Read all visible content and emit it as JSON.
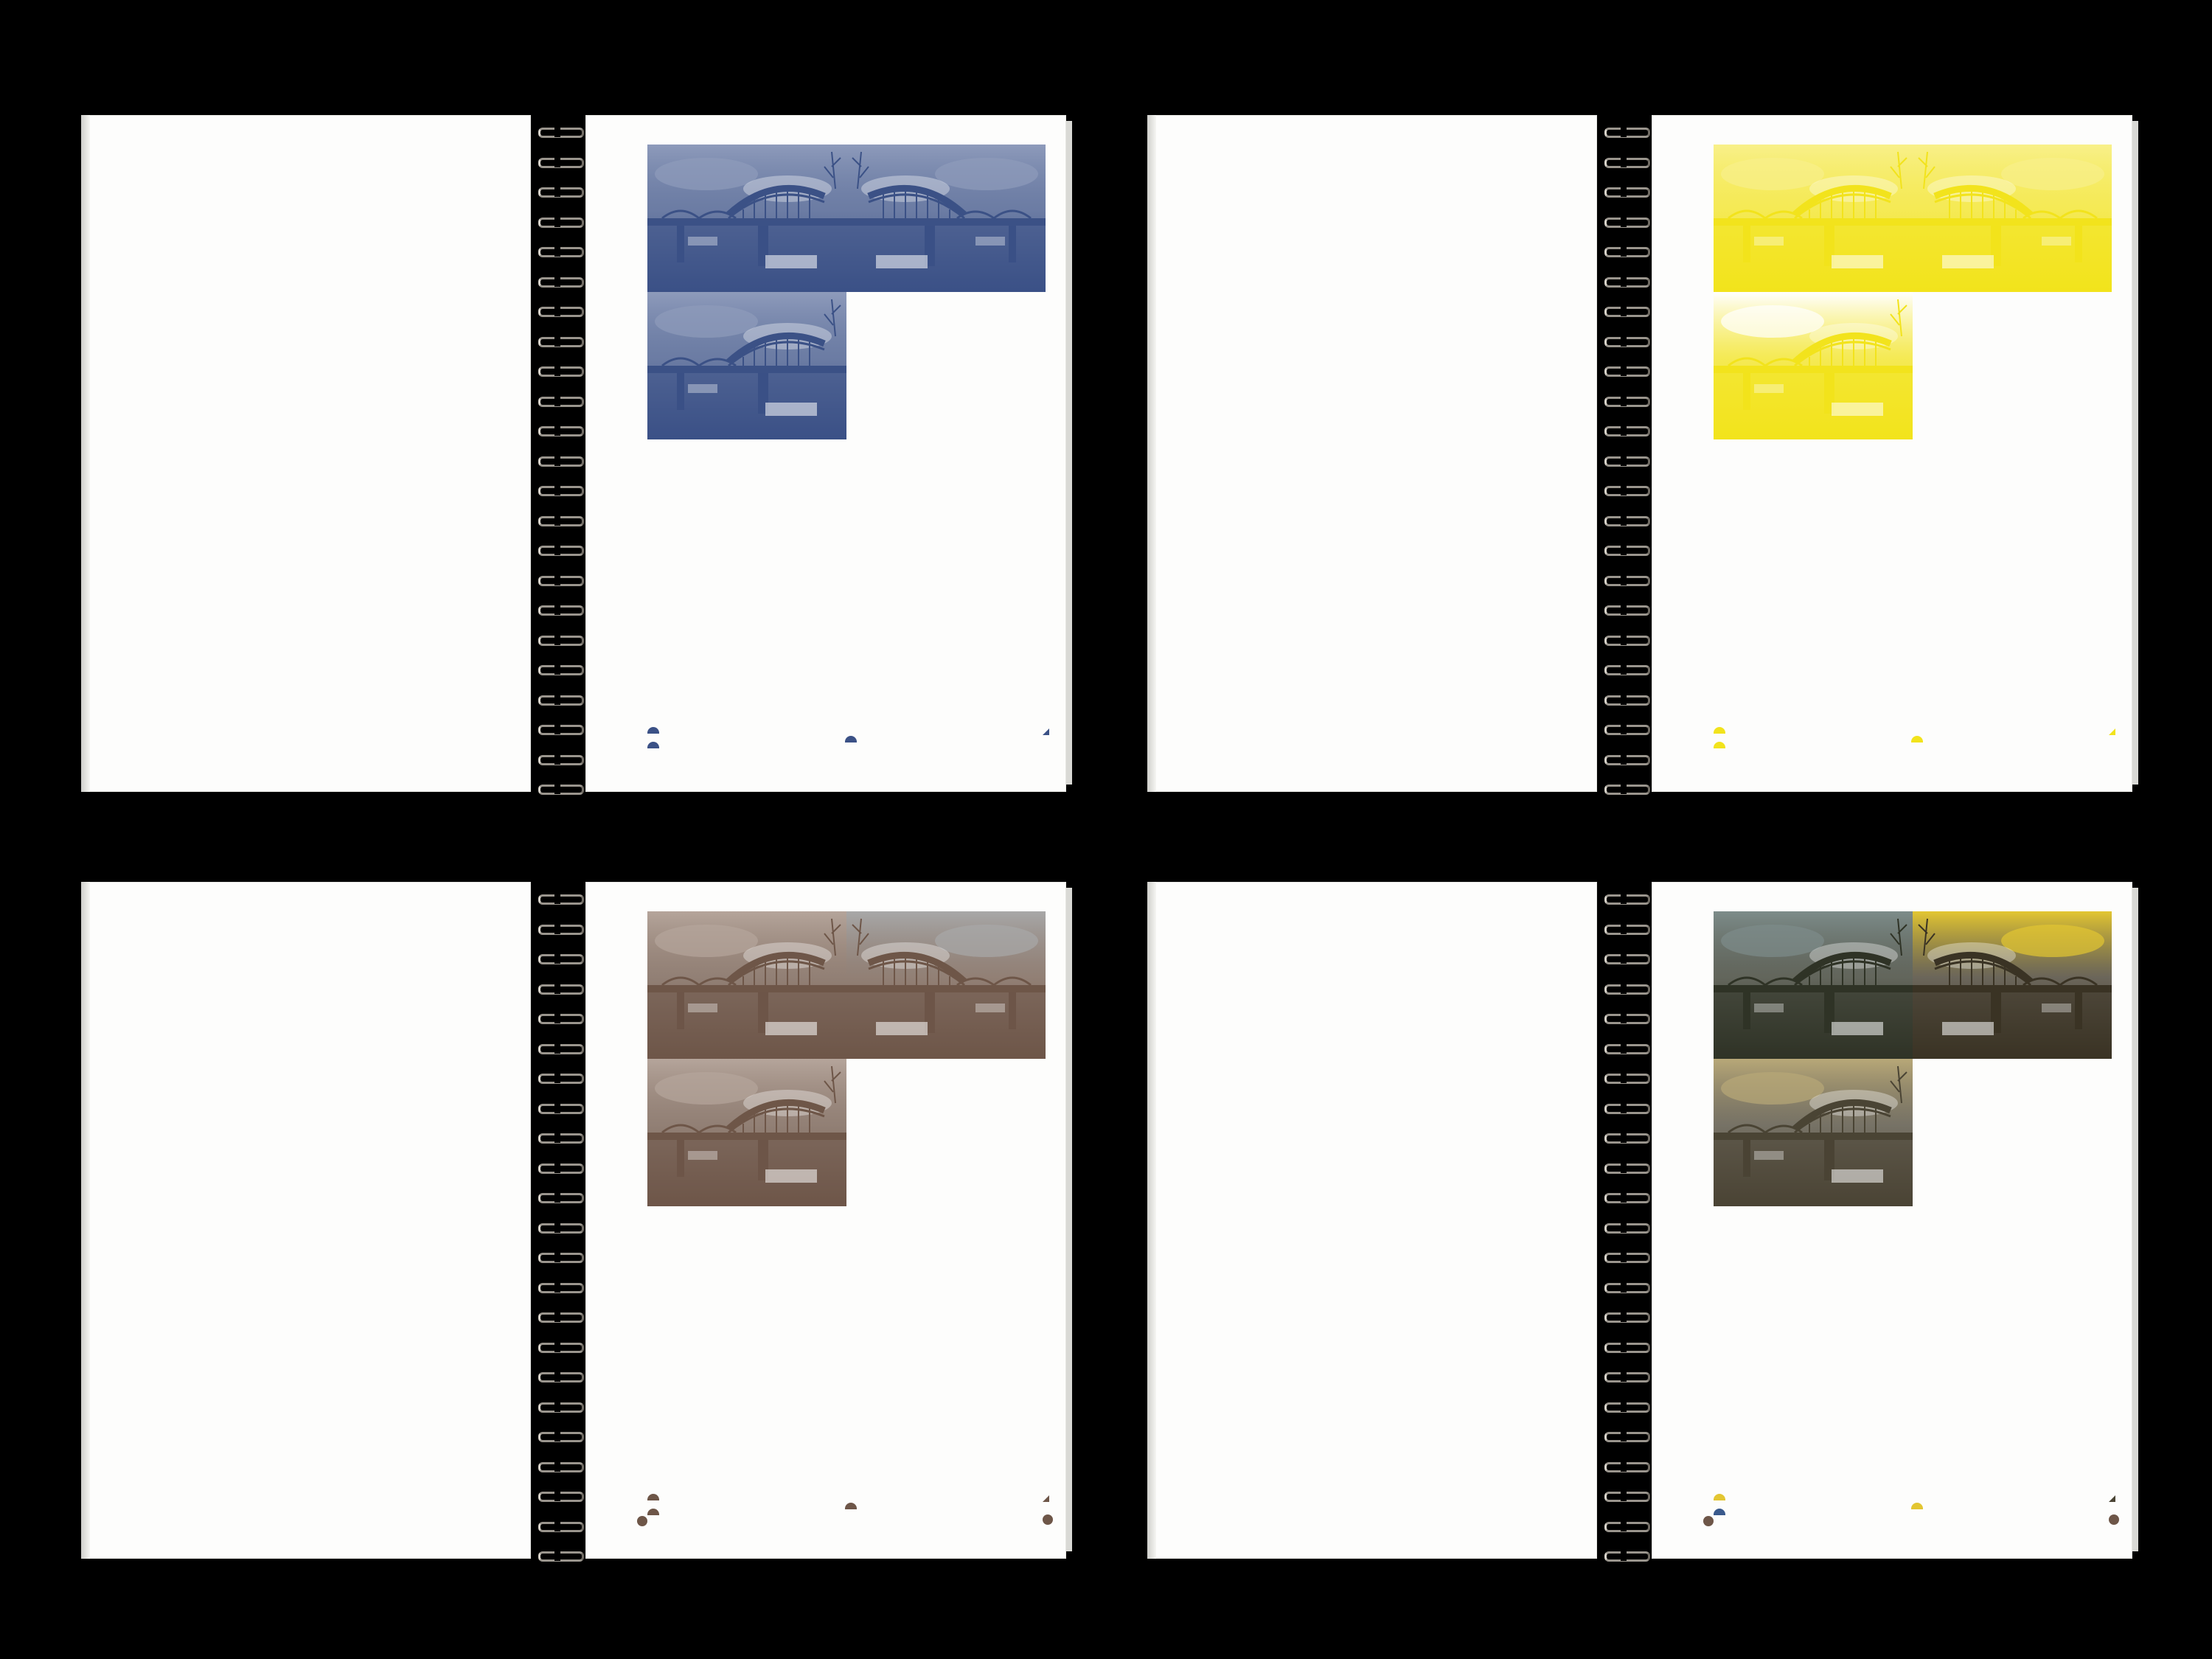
{
  "scene": {
    "description_hidden": "",
    "background": "#000000"
  },
  "spreads": [
    {
      "id": "blue",
      "ink": "#3b5186",
      "ink_light": "#8e9bbb",
      "paper": "#fdfdfc"
    },
    {
      "id": "yellow",
      "ink": "#f2e31c",
      "ink_light": "#f8f08a",
      "paper": "#fdfdfc"
    },
    {
      "id": "brown",
      "ink": "#6e5648",
      "ink_light": "#b5a59b",
      "paper": "#fdfdfc"
    },
    {
      "id": "multi",
      "ink": "#4a4434",
      "ink_light": "#b8a878",
      "paper": "#fdfdfc",
      "accent_yellow": "#e3c632",
      "accent_blue": "#3a5a8c"
    }
  ],
  "icons": [
    "bridge-photo-icon",
    "spiral-coil-icon",
    "registration-mark-icon"
  ]
}
